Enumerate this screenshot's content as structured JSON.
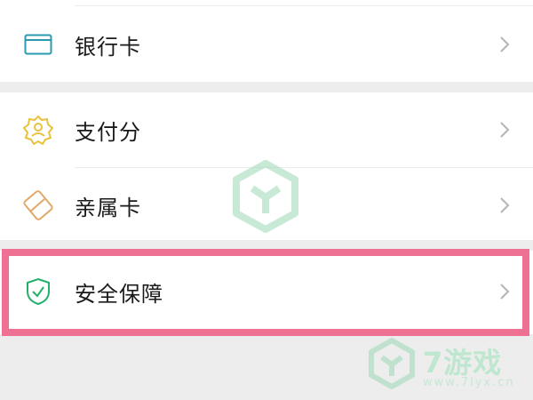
{
  "menu": {
    "items": [
      {
        "label": "银行卡",
        "icon": "bank-card-icon"
      },
      {
        "label": "支付分",
        "icon": "pay-score-icon"
      },
      {
        "label": "亲属卡",
        "icon": "family-card-icon"
      },
      {
        "label": "安全保障",
        "icon": "shield-check-icon"
      }
    ]
  },
  "watermark": {
    "brand": "7游戏",
    "url": "www.7lyx.cn"
  },
  "colors": {
    "highlight": "#ee7093",
    "bank_icon": "#2a9ab0",
    "pay_score_icon": "#e8c23a",
    "family_icon": "#e2a868",
    "security_icon": "#22b06b",
    "watermark": "#9ad8b4"
  }
}
